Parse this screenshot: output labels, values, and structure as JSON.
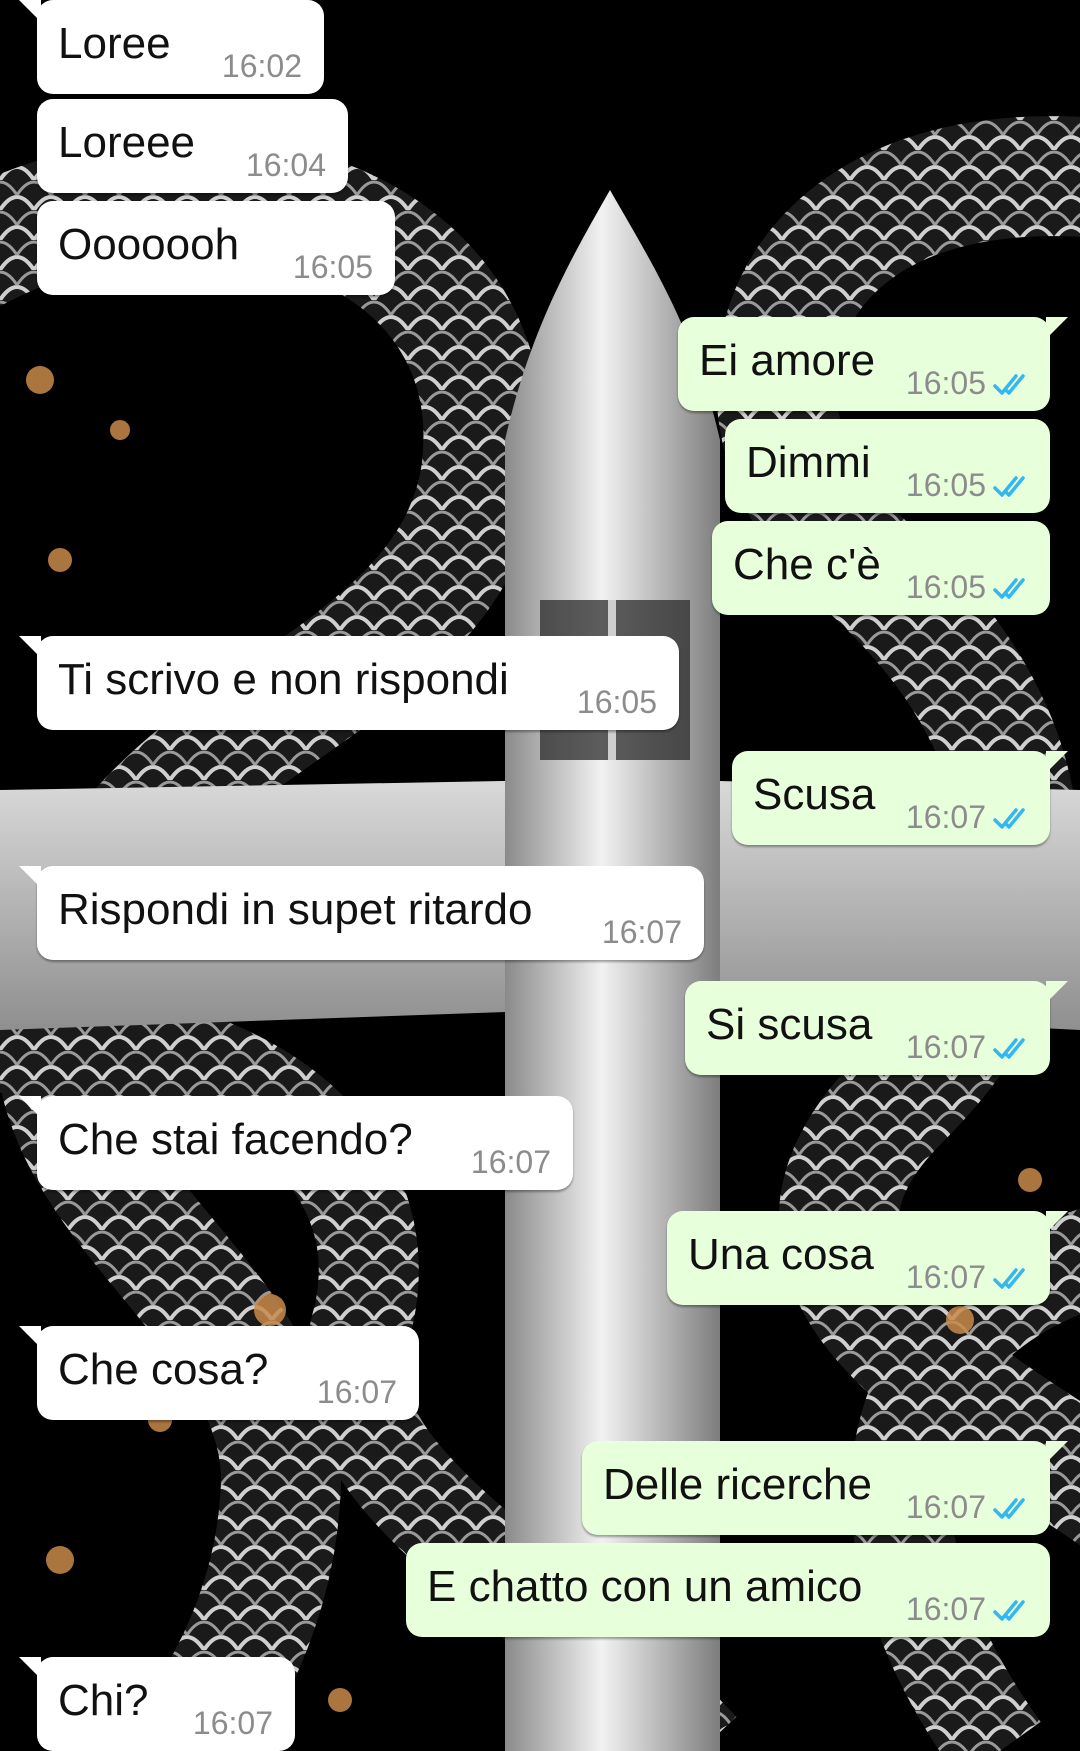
{
  "colors": {
    "incoming_bubble": "#ffffff",
    "outgoing_bubble": "#e7ffdb",
    "timestamp": "#8c8c8c",
    "read_ticks": "#34b7f1"
  },
  "icons": {
    "read_receipt": "double-check-icon"
  },
  "messages": [
    {
      "direction": "in",
      "text": "Loree",
      "time": "16:02"
    },
    {
      "direction": "in",
      "text": "Loreee",
      "time": "16:04"
    },
    {
      "direction": "in",
      "text": "Ooooooh",
      "time": "16:05"
    },
    {
      "direction": "out",
      "text": "Ei amore",
      "time": "16:05",
      "status": "read"
    },
    {
      "direction": "out",
      "text": "Dimmi",
      "time": "16:05",
      "status": "read"
    },
    {
      "direction": "out",
      "text": "Che c'è",
      "time": "16:05",
      "status": "read"
    },
    {
      "direction": "in",
      "text": "Ti scrivo e non rispondi",
      "time": "16:05"
    },
    {
      "direction": "out",
      "text": "Scusa",
      "time": "16:07",
      "status": "read"
    },
    {
      "direction": "in",
      "text": "Rispondi in supet ritardo",
      "time": "16:07"
    },
    {
      "direction": "out",
      "text": "Si scusa",
      "time": "16:07",
      "status": "read"
    },
    {
      "direction": "in",
      "text": "Che stai facendo?",
      "time": "16:07"
    },
    {
      "direction": "out",
      "text": "Una cosa",
      "time": "16:07",
      "status": "read"
    },
    {
      "direction": "in",
      "text": "Che cosa?",
      "time": "16:07"
    },
    {
      "direction": "out",
      "text": "Delle ricerche",
      "time": "16:07",
      "status": "read"
    },
    {
      "direction": "out",
      "text": "E chatto con un amico",
      "time": "16:07",
      "status": "read"
    },
    {
      "direction": "in",
      "text": "Chi?",
      "time": "16:07"
    }
  ]
}
